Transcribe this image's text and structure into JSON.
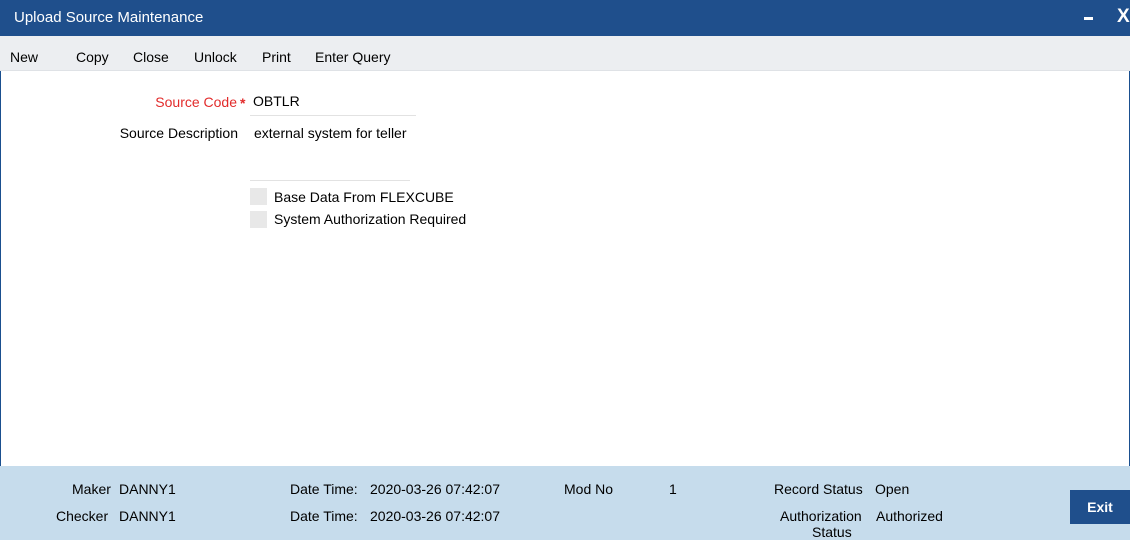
{
  "window": {
    "title": "Upload Source Maintenance",
    "minimize_icon": "minimize-icon",
    "close_label": "X",
    "title_bg": "#1f4f8c"
  },
  "toolbar": {
    "new": "New",
    "copy": "Copy",
    "close": "Close",
    "unlock": "Unlock",
    "print": "Print",
    "enter_query": "Enter Query"
  },
  "form": {
    "source_code_label": "Source Code",
    "required_marker": "*",
    "source_code_value": "OBTLR",
    "source_description_label": "Source Description",
    "source_description_value": "external system for teller",
    "base_data_label": "Base Data From FLEXCUBE",
    "base_data_checked": false,
    "sys_auth_label": "System Authorization Required",
    "sys_auth_checked": false
  },
  "footer": {
    "maker_label": "Maker",
    "maker_value": "DANNY1",
    "maker_datetime_label": "Date Time:",
    "maker_datetime_value": "2020-03-26 07:42:07",
    "checker_label": "Checker",
    "checker_value": "DANNY1",
    "checker_datetime_label": "Date Time:",
    "checker_datetime_value": "2020-03-26 07:42:07",
    "mod_no_label": "Mod No",
    "mod_no_value": "1",
    "record_status_label": "Record Status",
    "record_status_value": "Open",
    "auth_status_label_1": "Authorization",
    "auth_status_label_2": "Status",
    "auth_status_value": "Authorized",
    "exit_label": "Exit",
    "footer_bg": "#c6dcec"
  }
}
